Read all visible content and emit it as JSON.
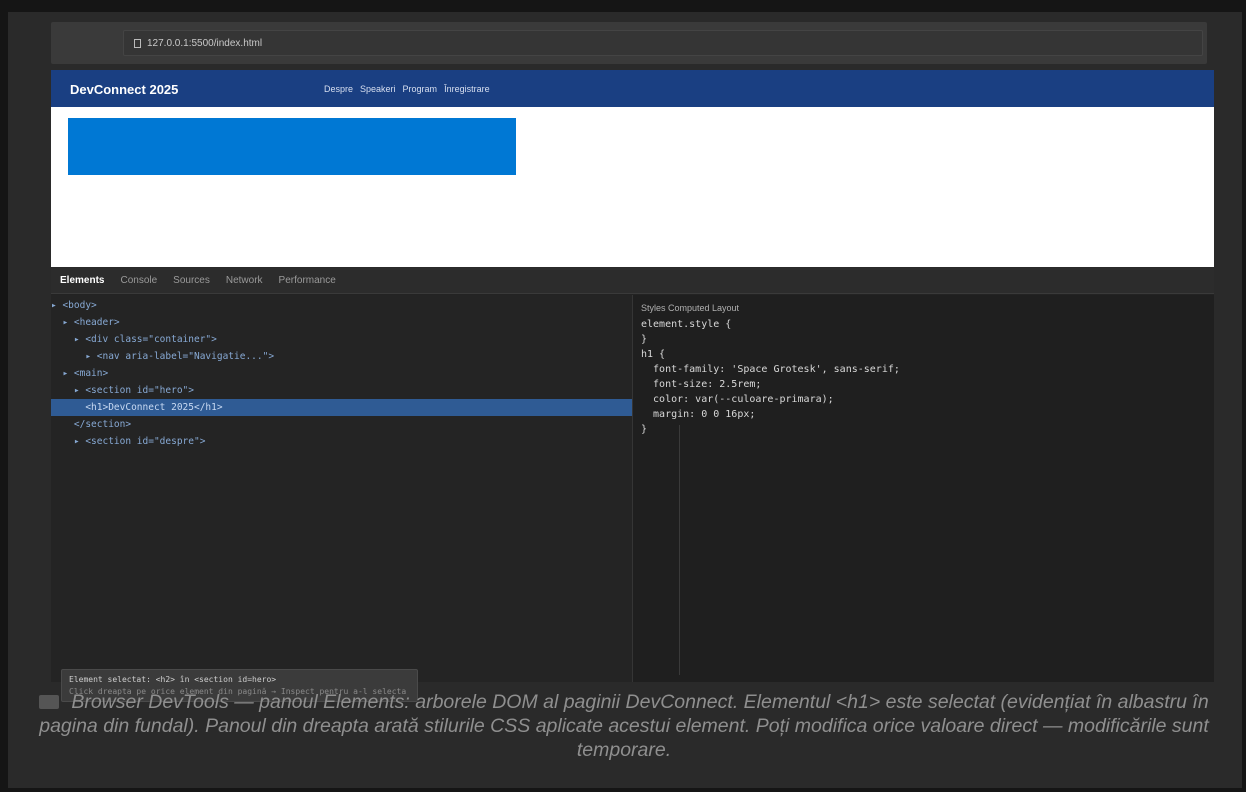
{
  "browser": {
    "url": "127.0.0.1:5500/index.html"
  },
  "site": {
    "logo": "DevConnect 2025",
    "nav": [
      "Despre",
      "Speakeri",
      "Program",
      "Înregistrare"
    ],
    "highlight_color": "#0078d4",
    "header_color": "#1a3f82"
  },
  "devtools": {
    "tabs": [
      "Elements",
      "Console",
      "Sources",
      "Network",
      "Performance"
    ],
    "active_tab": "Elements",
    "dom_tree": [
      {
        "text": "▸ <body>",
        "selected": false
      },
      {
        "text": "  ▸ <header>",
        "selected": false
      },
      {
        "text": "    ▸ <div class=\"container\">",
        "selected": false
      },
      {
        "text": "      ▸ <nav aria-label=\"Navigatie...\">",
        "selected": false
      },
      {
        "text": "  ▸ <main>",
        "selected": false
      },
      {
        "text": "    ▸ <section id=\"hero\">",
        "selected": false
      },
      {
        "text": "      <h1>DevConnect 2025</h1>",
        "selected": true
      },
      {
        "text": "    </section>",
        "selected": false
      },
      {
        "text": "    ▸ <section id=\"despre\">",
        "selected": false
      }
    ],
    "styles_tabs": "Styles  Computed  Layout",
    "css_rule": "element.style {\n}\nh1 {\n  font-family: 'Space Grotesk', sans-serif;\n  font-size: 2.5rem;\n  color: var(--culoare-primara);\n  margin: 0 0 16px;\n}",
    "tooltip": {
      "title": "Element selectat: <h2> în <section id=hero>",
      "subtitle": "Click dreapta pe orice element din pagină → Inspect pentru a-l selecta"
    }
  },
  "caption": "Browser DevTools — panoul Elements: arborele DOM al paginii DevConnect. Elementul <h1> este selectat (evidențiat în albastru în pagina din fundal). Panoul din dreapta arată stilurile CSS aplicate acestui element. Poți modifica orice valoare direct — modificările sunt temporare."
}
